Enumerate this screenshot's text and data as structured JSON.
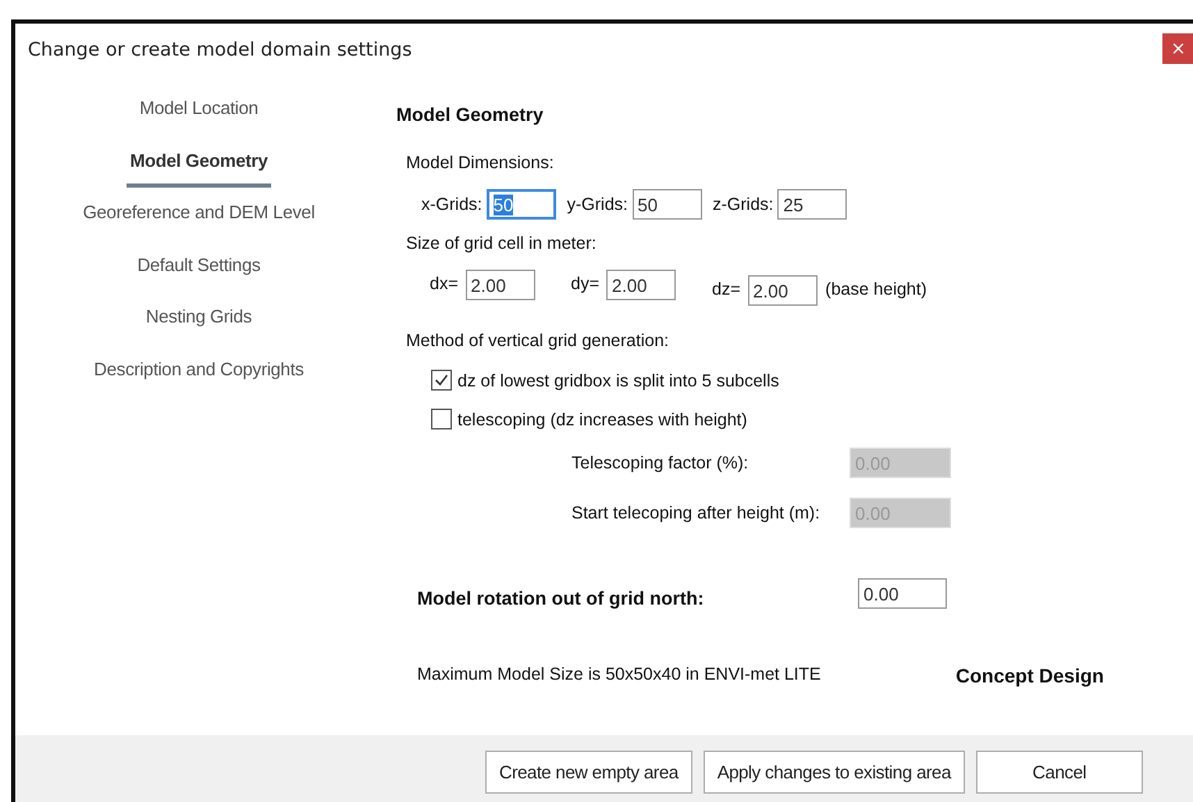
{
  "window": {
    "title": "Change or create model domain settings",
    "close": "×"
  },
  "sidebar": {
    "items": [
      {
        "label": "Model Location",
        "selected": false
      },
      {
        "label": "Model Geometry",
        "selected": true
      },
      {
        "label": "Georeference and DEM Level",
        "selected": false
      },
      {
        "label": "Default Settings",
        "selected": false
      },
      {
        "label": "Nesting Grids",
        "selected": false
      },
      {
        "label": "Description and Copyrights",
        "selected": false
      }
    ]
  },
  "heading": "Model Geometry",
  "dimensions": {
    "label": "Model Dimensions:",
    "fields": [
      {
        "label": "x-Grids:",
        "value": "50",
        "focused": true
      },
      {
        "label": "y-Grids:",
        "value": "50",
        "focused": false
      },
      {
        "label": "z-Grids:",
        "value": "25",
        "focused": false
      }
    ]
  },
  "cell_size": {
    "label": "Size of grid cell in meter:",
    "fields": [
      {
        "label": "dx=",
        "value": "2.00"
      },
      {
        "label": "dy=",
        "value": "2.00"
      },
      {
        "label": "dz=",
        "value": "2.00",
        "note": "(base height)"
      }
    ]
  },
  "method": {
    "label": "Method of vertical grid generation:",
    "options": [
      {
        "label": "dz of lowest gridbox is split into 5 subcells",
        "checked": true
      },
      {
        "label": "telescoping (dz increases with height)",
        "checked": false
      }
    ],
    "fields": [
      {
        "label": "Telescoping factor (%):",
        "value": "0.00",
        "disabled": true
      },
      {
        "label": "Start telecoping after height (m):",
        "value": "0.00",
        "disabled": true
      }
    ]
  },
  "rotation": {
    "label": "Model rotation out of grid north:",
    "value": "0.00"
  },
  "info": "Maximum Model Size is 50x50x40 in ENVI-met LITE",
  "edition": "Concept Design",
  "buttons": [
    "Create new empty area",
    "Apply changes to existing area",
    "Cancel"
  ]
}
